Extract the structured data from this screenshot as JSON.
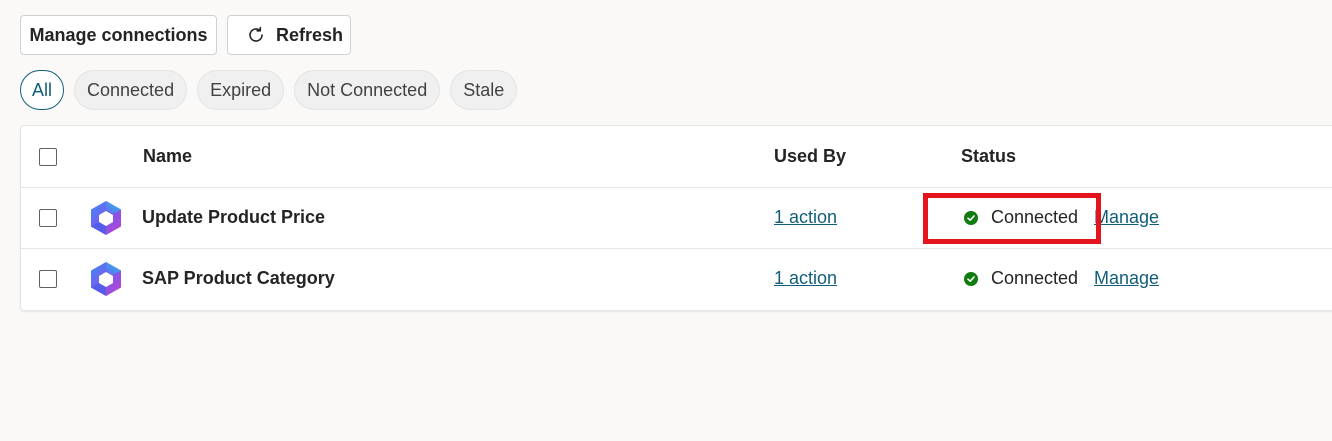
{
  "toolbar": {
    "manage_label": "Manage connections",
    "refresh_label": "Refresh",
    "refresh_icon": "refresh-icon"
  },
  "filters": [
    {
      "label": "All",
      "active": true
    },
    {
      "label": "Connected",
      "active": false
    },
    {
      "label": "Expired",
      "active": false
    },
    {
      "label": "Not Connected",
      "active": false
    },
    {
      "label": "Stale",
      "active": false
    }
  ],
  "table": {
    "columns": {
      "name": "Name",
      "used_by": "Used By",
      "status": "Status"
    },
    "rows": [
      {
        "name": "Update Product Price",
        "used_by": "1 action",
        "status": "Connected",
        "action": "Manage",
        "icon": "copilot-logo-icon"
      },
      {
        "name": "SAP Product Category",
        "used_by": "1 action",
        "status": "Connected",
        "action": "Manage",
        "icon": "copilot-logo-icon"
      }
    ]
  },
  "colors": {
    "accent": "#115e7a",
    "status_connected": "#107c10",
    "highlight": "#e3141c"
  }
}
